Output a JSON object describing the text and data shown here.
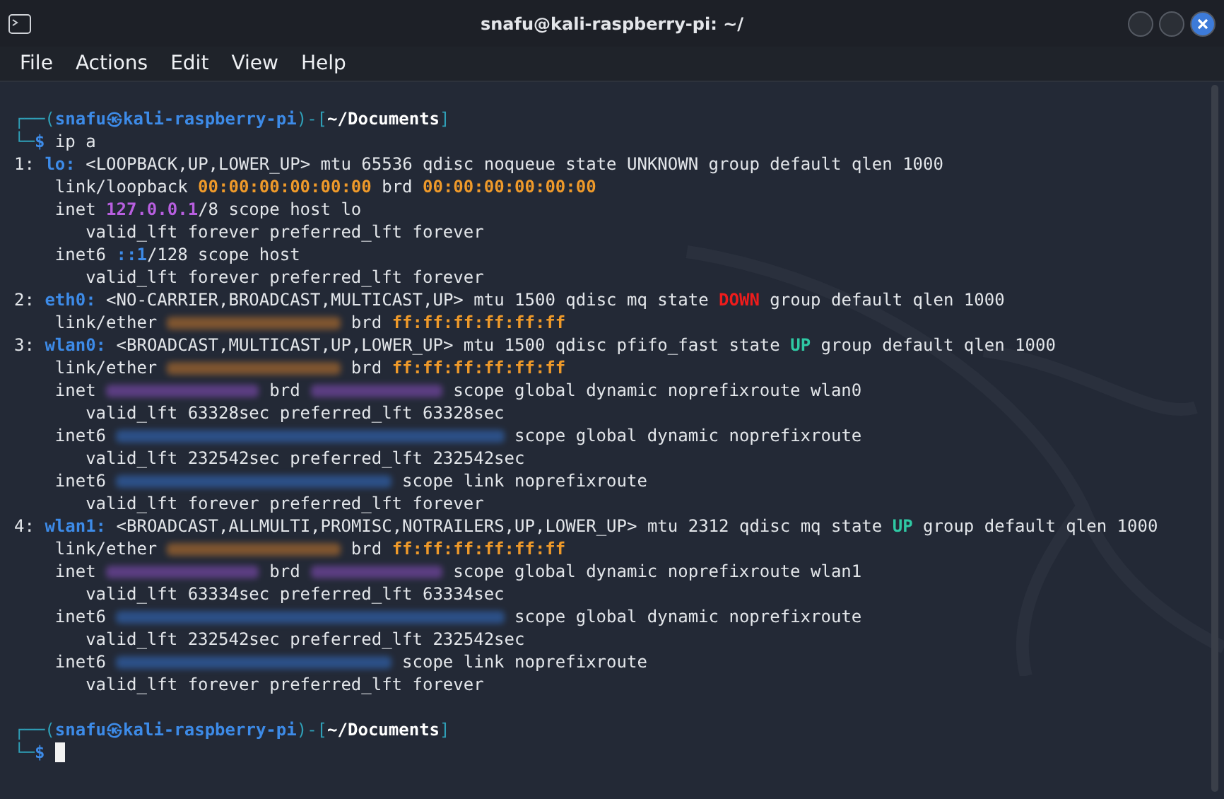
{
  "window": {
    "title": "snafu@kali-raspberry-pi: ~/"
  },
  "menu": [
    "File",
    "Actions",
    "Edit",
    "View",
    "Help"
  ],
  "terminal": {
    "output": [
      [
        {
          "kind": "box",
          "t": "┌──("
        },
        {
          "kind": "user",
          "t": "snafu㉿kali-raspberry-pi"
        },
        {
          "kind": "box",
          "t": ")-["
        },
        {
          "kind": "path",
          "t": "~/Documents"
        },
        {
          "kind": "box",
          "t": "]"
        }
      ],
      [
        {
          "kind": "box",
          "t": "└─"
        },
        {
          "kind": "dollar",
          "t": "$"
        },
        {
          "kind": "plain",
          "t": " ip a"
        }
      ],
      [
        {
          "kind": "plain",
          "t": "1: "
        },
        {
          "kind": "iface",
          "t": "lo:"
        },
        {
          "kind": "plain",
          "t": " <LOOPBACK,UP,LOWER_UP> mtu 65536 qdisc noqueue state UNKNOWN group default qlen 1000"
        }
      ],
      [
        {
          "kind": "plain",
          "t": "    link/loopback "
        },
        {
          "kind": "mac",
          "t": "00:00:00:00:00:00"
        },
        {
          "kind": "plain",
          "t": " brd "
        },
        {
          "kind": "mac",
          "t": "00:00:00:00:00:00"
        }
      ],
      [
        {
          "kind": "plain",
          "t": "    inet "
        },
        {
          "kind": "ip4",
          "t": "127.0.0.1"
        },
        {
          "kind": "plain",
          "t": "/8 scope host lo"
        }
      ],
      [
        {
          "kind": "plain",
          "t": "       valid_lft forever preferred_lft forever"
        }
      ],
      [
        {
          "kind": "plain",
          "t": "    inet6 "
        },
        {
          "kind": "ip6",
          "t": "::1"
        },
        {
          "kind": "plain",
          "t": "/128 scope host"
        }
      ],
      [
        {
          "kind": "plain",
          "t": "       valid_lft forever preferred_lft forever"
        }
      ],
      [
        {
          "kind": "plain",
          "t": "2: "
        },
        {
          "kind": "iface",
          "t": "eth0:"
        },
        {
          "kind": "plain",
          "t": " <NO-CARRIER,BROADCAST,MULTICAST,UP> mtu 1500 qdisc mq state "
        },
        {
          "kind": "down",
          "t": "DOWN"
        },
        {
          "kind": "plain",
          "t": " group default qlen 1000"
        }
      ],
      [
        {
          "kind": "plain",
          "t": "    link/ether "
        },
        {
          "kind": "blur-mac"
        },
        {
          "kind": "plain",
          "t": " brd "
        },
        {
          "kind": "mac",
          "t": "ff:ff:ff:ff:ff:ff"
        }
      ],
      [
        {
          "kind": "plain",
          "t": "3: "
        },
        {
          "kind": "iface",
          "t": "wlan0:"
        },
        {
          "kind": "plain",
          "t": " <BROADCAST,MULTICAST,UP,LOWER_UP> mtu 1500 qdisc pfifo_fast state "
        },
        {
          "kind": "up",
          "t": "UP"
        },
        {
          "kind": "plain",
          "t": " group default qlen 1000"
        }
      ],
      [
        {
          "kind": "plain",
          "t": "    link/ether "
        },
        {
          "kind": "blur-mac"
        },
        {
          "kind": "plain",
          "t": " brd "
        },
        {
          "kind": "mac",
          "t": "ff:ff:ff:ff:ff:ff"
        }
      ],
      [
        {
          "kind": "plain",
          "t": "    inet "
        },
        {
          "kind": "blur-ip4cidr"
        },
        {
          "kind": "plain",
          "t": " brd "
        },
        {
          "kind": "blur-ip4"
        },
        {
          "kind": "plain",
          "t": " scope global dynamic noprefixroute wlan0"
        }
      ],
      [
        {
          "kind": "plain",
          "t": "       valid_lft 63328sec preferred_lft 63328sec"
        }
      ],
      [
        {
          "kind": "plain",
          "t": "    inet6 "
        },
        {
          "kind": "blur-ip6global"
        },
        {
          "kind": "plain",
          "t": " scope global dynamic noprefixroute"
        }
      ],
      [
        {
          "kind": "plain",
          "t": "       valid_lft 232542sec preferred_lft 232542sec"
        }
      ],
      [
        {
          "kind": "plain",
          "t": "    inet6 "
        },
        {
          "kind": "blur-ip6link"
        },
        {
          "kind": "plain",
          "t": " scope link noprefixroute"
        }
      ],
      [
        {
          "kind": "plain",
          "t": "       valid_lft forever preferred_lft forever"
        }
      ],
      [
        {
          "kind": "plain",
          "t": "4: "
        },
        {
          "kind": "iface",
          "t": "wlan1:"
        },
        {
          "kind": "plain",
          "t": " <BROADCAST,ALLMULTI,PROMISC,NOTRAILERS,UP,LOWER_UP> mtu 2312 qdisc mq state "
        },
        {
          "kind": "up",
          "t": "UP"
        },
        {
          "kind": "plain",
          "t": " group default qlen 1000"
        }
      ],
      [
        {
          "kind": "plain",
          "t": "    link/ether "
        },
        {
          "kind": "blur-mac"
        },
        {
          "kind": "plain",
          "t": " brd "
        },
        {
          "kind": "mac",
          "t": "ff:ff:ff:ff:ff:ff"
        }
      ],
      [
        {
          "kind": "plain",
          "t": "    inet "
        },
        {
          "kind": "blur-ip4cidr"
        },
        {
          "kind": "plain",
          "t": " brd "
        },
        {
          "kind": "blur-ip4"
        },
        {
          "kind": "plain",
          "t": " scope global dynamic noprefixroute wlan1"
        }
      ],
      [
        {
          "kind": "plain",
          "t": "       valid_lft 63334sec preferred_lft 63334sec"
        }
      ],
      [
        {
          "kind": "plain",
          "t": "    inet6 "
        },
        {
          "kind": "blur-ip6global"
        },
        {
          "kind": "plain",
          "t": " scope global dynamic noprefixroute"
        }
      ],
      [
        {
          "kind": "plain",
          "t": "       valid_lft 232542sec preferred_lft 232542sec"
        }
      ],
      [
        {
          "kind": "plain",
          "t": "    inet6 "
        },
        {
          "kind": "blur-ip6link"
        },
        {
          "kind": "plain",
          "t": " scope link noprefixroute"
        }
      ],
      [
        {
          "kind": "plain",
          "t": "       valid_lft forever preferred_lft forever"
        }
      ]
    ],
    "prompt": [
      [
        {
          "kind": "box",
          "t": "┌──("
        },
        {
          "kind": "user",
          "t": "snafu㉿kali-raspberry-pi"
        },
        {
          "kind": "box",
          "t": ")-["
        },
        {
          "kind": "path",
          "t": "~/Documents"
        },
        {
          "kind": "box",
          "t": "]"
        }
      ],
      [
        {
          "kind": "box",
          "t": "└─"
        },
        {
          "kind": "dollar",
          "t": "$"
        },
        {
          "kind": "cursor"
        }
      ]
    ]
  }
}
